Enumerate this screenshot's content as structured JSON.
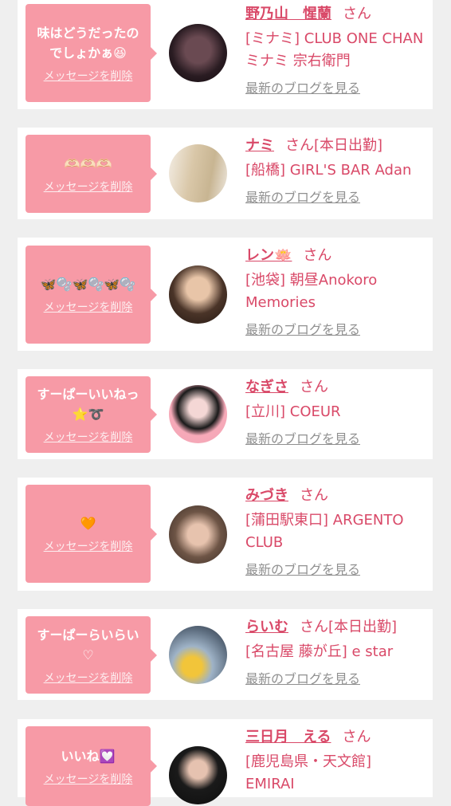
{
  "delete_label": "メッセージを削除",
  "blog_label": "最新のブログを見る",
  "san_label": "さん",
  "items": [
    {
      "message": "味はどうだったの\nでしょかぁ😆",
      "name": "野乃山　惺蘭",
      "tag": "",
      "shop": "[ミナミ] CLUB ONE CHAN ミナミ 宗右衛門"
    },
    {
      "message": "🫶🏻🫶🏻🫶🏻",
      "name": "ナミ",
      "tag": "[本日出勤]",
      "shop": "[船橋] GIRL'S BAR Adan"
    },
    {
      "message": "🦋🫧🦋🫧🦋🫧",
      "name": "レン🪷",
      "tag": "",
      "shop": "[池袋] 朝昼Anokoro Memories"
    },
    {
      "message": "すーぱーいいねっ\n⭐️➰",
      "name": "なぎさ",
      "tag": "",
      "shop": "[立川] COEUR"
    },
    {
      "message": "🧡",
      "name": "みづき",
      "tag": "",
      "shop": "[蒲田駅東口] ARGENTO CLUB"
    },
    {
      "message": "すーぱーらいらい\n♡",
      "name": "らいむ",
      "tag": "[本日出勤]",
      "shop": "[名古屋 藤が丘] e star"
    },
    {
      "message": "いいね💟",
      "name": "三日月　える",
      "tag": "",
      "shop": "[鹿児島県・天文館] EMIRAI"
    }
  ],
  "colors": {
    "accent": "#d94968",
    "bubble": "#f79aa6",
    "background": "#efefef",
    "link_gray": "#909090"
  }
}
